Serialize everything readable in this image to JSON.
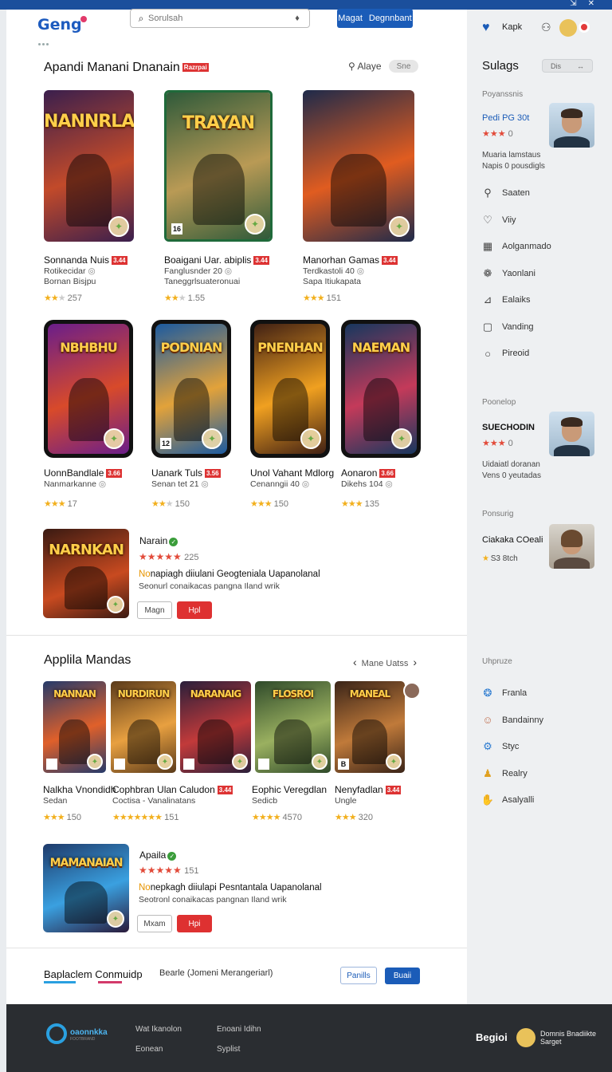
{
  "topbar": {
    "icons": [
      "restore-icon",
      "close-icon"
    ]
  },
  "header": {
    "logo": "Geng",
    "search": {
      "placeholder": "Sorulsah"
    },
    "primary_button": {
      "label_a": "Magat",
      "label_b": "Degnnbant"
    }
  },
  "section1": {
    "title": "Apandi Manani Dnanain",
    "tag": "Razrpai",
    "align_label": "Alaye",
    "pill_label": "Sne",
    "poster_cards": [
      {
        "art_title": "NANNRLAN",
        "name": "Sonnanda Nuis",
        "tag": "3.44",
        "line1": "Rotikecidar",
        "line2": "Bornan Bisjpu",
        "rating_text": "257",
        "stars": 2,
        "colors": [
          "#3a1f4d",
          "#c24a2a"
        ],
        "badge": "✦"
      },
      {
        "art_title": "TRAYAN",
        "name": "Boaigani Uar. abiplis",
        "tag": "3.44",
        "line1": "Fanglusnder 20",
        "line2": "Taneggrlsuateronuai",
        "rating_text": "1.55",
        "stars": 2,
        "colors": [
          "#2f5a3a",
          "#b99a55"
        ],
        "badge": "✦",
        "corner": "16"
      },
      {
        "art_title": "",
        "name": "Manorhan Gamas",
        "tag": "3.44",
        "line1": "Terdkastoli 40",
        "line2": "Sapa Itiukapata",
        "rating_text": "151",
        "stars": 3,
        "colors": [
          "#1e2a4a",
          "#e05c20"
        ],
        "badge": "✦"
      }
    ],
    "phone_cards": [
      {
        "art_title": "NBHBHU",
        "name": "UonnBandlale",
        "tag": "3.66",
        "line1": "Nanmarkanne",
        "rating_text": "17",
        "stars": 3,
        "colors": [
          "#6a1e8a",
          "#d84a2a"
        ]
      },
      {
        "art_title": "PODNIAN",
        "name": "Uanark Tuls",
        "tag": "3.56",
        "line1": "Senan tet 21",
        "rating_text": "150",
        "stars": 2,
        "colors": [
          "#1b5aa0",
          "#e2a23a"
        ],
        "corner": "12"
      },
      {
        "art_title": "PNENHAN",
        "name": "Unol Vahant Mdlorg",
        "tag": "",
        "line1": "Cenanngii 40",
        "rating_text": "150",
        "stars": 3,
        "colors": [
          "#402014",
          "#f0a020"
        ]
      },
      {
        "art_title": "NAEMAN",
        "name": "Aonaron",
        "tag": "3.66",
        "line1": "Dikehs 104",
        "rating_text": "135",
        "stars": 3,
        "colors": [
          "#17375e",
          "#c43a5a"
        ]
      }
    ],
    "feature": {
      "art_title": "NARNKAN",
      "title": "Narain",
      "rating_text": "225",
      "desc_highlight": "No",
      "desc_main": "napiagh diiulani Geogteniala Uapanolanal",
      "desc_small": "Seonurl conaikacas pangna Iland wrik",
      "btn_outline": "Magn",
      "btn_red": "Hpl"
    }
  },
  "section2": {
    "title": "Applila Mandas",
    "nav_label": "Mane Uatss",
    "square_cards": [
      {
        "art_title": "NANNAN",
        "colors": [
          "#253a6a",
          "#e0602a"
        ]
      },
      {
        "art_title": "NURDIRUN",
        "colors": [
          "#5a3a1a",
          "#e8a040"
        ]
      },
      {
        "art_title": "NARANAIG",
        "colors": [
          "#2a1f3a",
          "#c23a3a"
        ]
      },
      {
        "art_title": "FLOSROI",
        "colors": [
          "#2f4a2a",
          "#9ab060"
        ]
      },
      {
        "art_title": "MANEAL",
        "colors": [
          "#3a2418",
          "#c07a3a"
        ],
        "corner": "B"
      }
    ],
    "item_texts": [
      {
        "name": "Nalkha Vnondidh",
        "line1": "Sedan",
        "rating_text": "150",
        "stars": 3
      },
      {
        "name": "Cophbran Ulan Caludon",
        "tag": "3.44",
        "line1": "Coctisa - Vanalinatans",
        "rating_text": "151",
        "stars": 7
      },
      {
        "name": "Eophic Veregdlan",
        "line1": "Sedicb",
        "rating_text": "4570",
        "stars": 4
      },
      {
        "name": "Nenyfadlan",
        "tag": "3.44",
        "line1": "Ungle",
        "rating_text": "320",
        "stars": 3
      }
    ],
    "feature": {
      "art_title": "MAMANAIAN",
      "title": "Apaila",
      "rating_text": "151",
      "desc_highlight": "No",
      "desc_main": "nepkagh diiulapi Pesntantala Uapanolanal",
      "desc_small": "Seotronl conaikacas pangnan Iland wrik",
      "btn_outline": "Mxam",
      "btn_red": "Hpi"
    }
  },
  "bottom_banner": {
    "title": "Baplaclem Conmuidp",
    "desc": "Bearle (Jomeni Merangeriarl)",
    "btn_outline": "Panills",
    "btn_blue": "Buaii"
  },
  "sidebar": {
    "user_label": "Kapk",
    "title": "Sulags",
    "ctrl_a": "Dis",
    "ctrl_b": "↔",
    "label_popular": "Poyanssnis",
    "person1": {
      "name": "Pedi PG 30t",
      "stars": 3,
      "rating_text": "0"
    },
    "person1_meta_a": "Muaria lamstaus",
    "person1_meta_b": "Napis 0 pousdigls",
    "menu": [
      {
        "label": "Saaten",
        "icon": "search-icon"
      },
      {
        "label": "Viiy",
        "icon": "heart-icon"
      },
      {
        "label": "Aolganmado",
        "icon": "grid-icon"
      },
      {
        "label": "Yaonlani",
        "icon": "shapes-icon"
      },
      {
        "label": "Ealaiks",
        "icon": "chart-icon"
      },
      {
        "label": "Vanding",
        "icon": "bookmark-icon"
      },
      {
        "label": "Pireoid",
        "icon": "chat-icon"
      }
    ],
    "label_ponelop": "Poonelop",
    "person2": {
      "name": "SUECHODIN",
      "stars": 3,
      "rating_text": "0"
    },
    "person2_meta_a": "Uidaiatl doranan",
    "person2_meta_b": "Vens 0 yeutadas",
    "label_ponsurig": "Ponsurig",
    "person3": {
      "name": "Ciakaka COeali",
      "rating_text": "S3 8tch"
    },
    "label_uhpruze": "Uhpruze",
    "menu2": [
      {
        "label": "Franla",
        "icon": "flame-icon"
      },
      {
        "label": "Bandainny",
        "icon": "user-icon"
      },
      {
        "label": "Styc",
        "icon": "robot-icon"
      },
      {
        "label": "Realry",
        "icon": "person-icon"
      },
      {
        "label": "Asalyalli",
        "icon": "hand-icon"
      }
    ]
  },
  "footer": {
    "logo_text": "oaonnkka",
    "logo_sub": "FOOTBRAND",
    "col1": [
      "Wat Ikanolon",
      "Eonean"
    ],
    "col2": [
      "Enoani Idihn",
      "Syplist"
    ],
    "brand": "Begioi",
    "user_a": "Domnis Bnadiikte",
    "user_b": "Sarget"
  },
  "colors": {
    "accent": "#1b5cb8",
    "danger": "#de3131",
    "star": "#f2b01e",
    "topbar": "#1b4f9c",
    "footer": "#2a2d31"
  }
}
